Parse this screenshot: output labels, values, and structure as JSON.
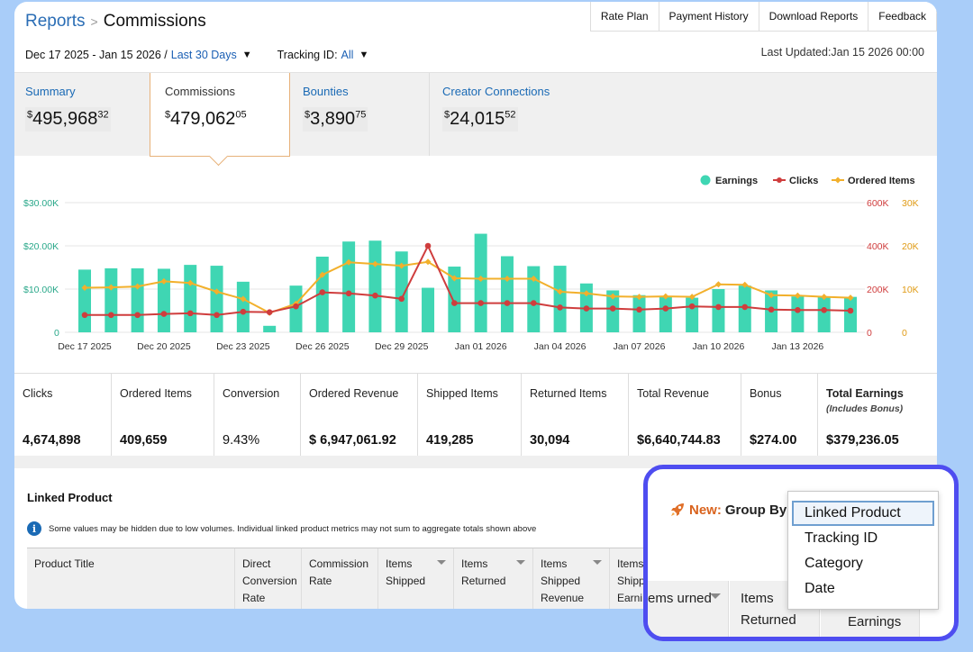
{
  "topnav": [
    "Rate Plan",
    "Payment History",
    "Download Reports",
    "Feedback"
  ],
  "breadcrumb": {
    "parent": "Reports",
    "current": "Commissions"
  },
  "filters": {
    "date_range": "Dec 17 2025 - Jan 15 2026 /",
    "period": "Last 30 Days",
    "tracking_label": "Tracking ID:",
    "tracking_value": "All"
  },
  "last_updated": "Last Updated:Jan 15 2026 00:00",
  "tabs": [
    {
      "label": "Summary",
      "dollar": "$",
      "main": "495,968",
      "cents": "32"
    },
    {
      "label": "Commissions",
      "dollar": "$",
      "main": "479,062",
      "cents": "05"
    },
    {
      "label": "Bounties",
      "dollar": "$",
      "main": "3,890",
      "cents": "75"
    },
    {
      "label": "Creator Connections",
      "dollar": "$",
      "main": "24,015",
      "cents": "52"
    }
  ],
  "colors": {
    "earnings": "#3fd6b3",
    "clicks": "#cf3d3d",
    "ordered_items": "#f2b02c",
    "accent_blue": "#1a6ab5",
    "highlight_border": "#4e4df0",
    "new_orange": "#d9631e"
  },
  "chart_data": {
    "type": "bar",
    "legend": [
      "Earnings",
      "Clicks",
      "Ordered Items"
    ],
    "legend_position": "top-right",
    "y_left_ticks": [
      "$30.00K",
      "$20.00K",
      "$10.00K",
      "0"
    ],
    "y_right1_ticks": [
      "600K",
      "400K",
      "200K",
      "0"
    ],
    "y_right2_ticks": [
      "30K",
      "20K",
      "10K",
      "0"
    ],
    "x_tick_labels": [
      "Dec 17 2025",
      "Dec 20 2025",
      "Dec 23 2025",
      "Dec 26 2025",
      "Dec 29 2025",
      "Jan 01 2026",
      "Jan 04 2026",
      "Jan 07 2026",
      "Jan 10 2026",
      "Jan 13 2026"
    ],
    "x": [
      "Dec 17",
      "Dec 18",
      "Dec 19",
      "Dec 20",
      "Dec 21",
      "Dec 22",
      "Dec 23",
      "Dec 24",
      "Dec 25",
      "Dec 26",
      "Dec 27",
      "Dec 28",
      "Dec 29",
      "Dec 30",
      "Dec 31",
      "Jan 01",
      "Jan 02",
      "Jan 03",
      "Jan 04",
      "Jan 05",
      "Jan 06",
      "Jan 07",
      "Jan 08",
      "Jan 09",
      "Jan 10",
      "Jan 11",
      "Jan 12",
      "Jan 13",
      "Jan 14",
      "Jan 15"
    ],
    "series": [
      {
        "name": "Earnings",
        "type": "bar",
        "axis": "left",
        "ylim": [
          0,
          30000
        ],
        "values": [
          14500,
          14800,
          14800,
          14700,
          15600,
          15400,
          11700,
          1500,
          10800,
          17500,
          21000,
          21200,
          18700,
          10300,
          15200,
          22800,
          17600,
          15300,
          15400,
          11300,
          9700,
          8600,
          8300,
          8000,
          10000,
          10800,
          9700,
          8300,
          8300,
          8200
        ]
      },
      {
        "name": "Clicks",
        "type": "line",
        "axis": "right1",
        "ylim": [
          0,
          600000
        ],
        "values": [
          80000,
          80000,
          80000,
          85000,
          88000,
          80000,
          95000,
          93000,
          120000,
          185000,
          180000,
          170000,
          155000,
          400000,
          135000,
          135000,
          135000,
          135000,
          115000,
          110000,
          110000,
          105000,
          110000,
          120000,
          117000,
          117000,
          105000,
          103000,
          103000,
          100000
        ]
      },
      {
        "name": "Ordered Items",
        "type": "line",
        "axis": "right2",
        "ylim": [
          0,
          30000
        ],
        "values": [
          10300,
          10400,
          10600,
          11800,
          11400,
          9400,
          7700,
          4500,
          6600,
          13300,
          16200,
          15800,
          15400,
          16300,
          12500,
          12400,
          12400,
          12400,
          9400,
          9000,
          8300,
          8200,
          8300,
          8200,
          11100,
          11000,
          8600,
          8500,
          8200,
          8000
        ]
      }
    ]
  },
  "metrics": [
    {
      "label": "Clicks",
      "value": "4,674,898"
    },
    {
      "label": "Ordered Items",
      "value": "409,659"
    },
    {
      "label": "Conversion",
      "value": "9.43%"
    },
    {
      "label": "Ordered Revenue",
      "value": "$ 6,947,061.92"
    },
    {
      "label": "Shipped Items",
      "value": "419,285"
    },
    {
      "label": "Returned Items",
      "value": "30,094"
    },
    {
      "label": "Total Revenue",
      "value": "$6,640,744.83"
    },
    {
      "label": "Bonus",
      "value": "$274.00"
    },
    {
      "label": "Total Earnings",
      "sub": "(Includes Bonus)",
      "value": "$379,236.05"
    }
  ],
  "linked_product": {
    "title": "Linked Product",
    "info": "Some values may be hidden due to low volumes. Individual linked product metrics may not sum to aggregate totals shown above",
    "columns": [
      "Product Title",
      "Direct Conversion Rate",
      "Commission Rate",
      "Items Shipped",
      "Items Returned",
      "Items Shipped Revenue",
      "Items Shipp Earni"
    ]
  },
  "group_by": {
    "new_label": "New:",
    "label": "Group By:",
    "options": [
      "Linked Product",
      "Tracking ID",
      "Category",
      "Date"
    ],
    "selected": "Linked Product",
    "bg_columns": [
      "ems urned",
      "Items Returned",
      "Earnings"
    ]
  }
}
